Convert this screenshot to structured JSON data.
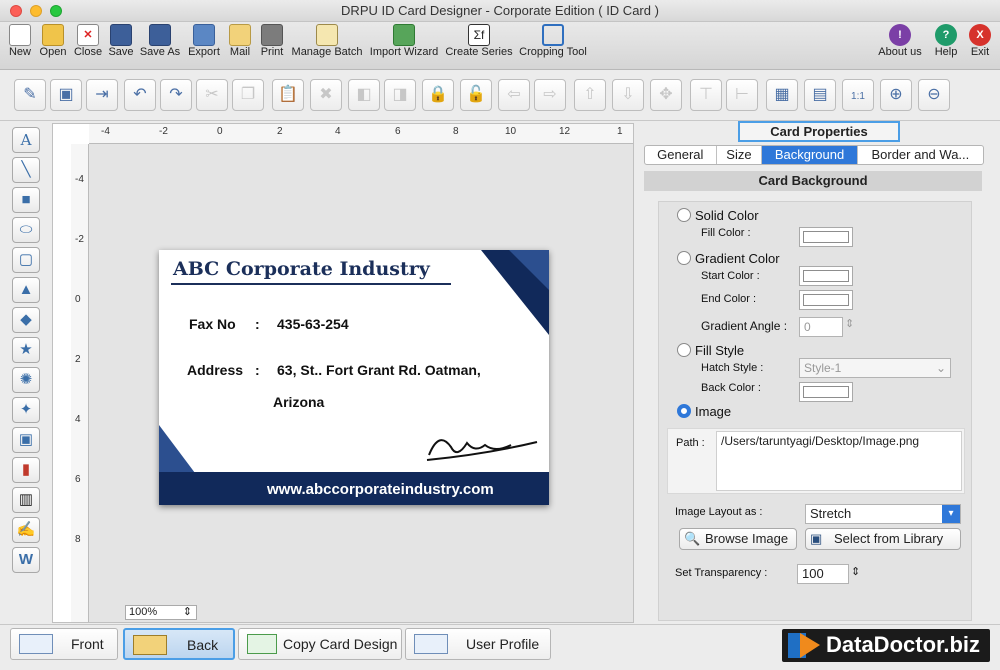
{
  "window": {
    "title": "DRPU ID Card Designer - Corporate Edition ( ID Card )"
  },
  "toolbar": {
    "items": [
      {
        "label": "New",
        "icon": "new-document-icon"
      },
      {
        "label": "Open",
        "icon": "open-folder-icon"
      },
      {
        "label": "Close",
        "icon": "close-document-icon"
      },
      {
        "label": "Save",
        "icon": "save-icon"
      },
      {
        "label": "Save As",
        "icon": "save-as-icon"
      },
      {
        "label": "Export",
        "icon": "export-icon"
      },
      {
        "label": "Mail",
        "icon": "mail-icon"
      },
      {
        "label": "Print",
        "icon": "printer-icon"
      },
      {
        "label": "Manage Batch",
        "icon": "manage-batch-icon"
      },
      {
        "label": "Import Wizard",
        "icon": "import-wizard-icon"
      },
      {
        "label": "Create Series",
        "icon": "create-series-icon"
      },
      {
        "label": "Cropping Tool",
        "icon": "crop-icon"
      }
    ],
    "right": [
      {
        "label": "About us",
        "icon": "info-icon",
        "color": "#7b3fa6"
      },
      {
        "label": "Help",
        "icon": "help-icon",
        "color": "#1f9b6a"
      },
      {
        "label": "Exit",
        "icon": "exit-icon",
        "color": "#d6322c"
      }
    ]
  },
  "ruler": {
    "h_ticks": [
      "-4",
      "-2",
      "0",
      "2",
      "4",
      "6",
      "8",
      "10",
      "12",
      "1"
    ],
    "v_ticks": [
      "-4",
      "-2",
      "0",
      "2",
      "4",
      "6",
      "8"
    ]
  },
  "zoom": {
    "value": "100%"
  },
  "card": {
    "title": "ABC Corporate Industry",
    "fax_label": "Fax No",
    "fax_sep": ":",
    "fax_value": "435-63-254",
    "address_label": "Address",
    "address_sep": ":",
    "address_line1": "63, St.. Fort Grant Rd. Oatman,",
    "address_line2": "Arizona",
    "website": "www.abccorporateindustry.com",
    "colors": {
      "navy": "#11295a",
      "accent": "#1b3a74"
    }
  },
  "panel": {
    "title": "Card Properties",
    "tabs": [
      "General",
      "Size",
      "Background",
      "Border and Wa..."
    ],
    "active_tab": "Background",
    "section": "Card Background",
    "solid_color": "Solid Color",
    "fill_color": "Fill Color :",
    "gradient_color": "Gradient Color",
    "start_color": "Start Color :",
    "end_color": "End Color :",
    "gradient_angle": "Gradient Angle :",
    "gradient_angle_value": "0",
    "fill_style": "Fill Style",
    "hatch_style": "Hatch Style :",
    "hatch_value": "Style-1",
    "back_color": "Back Color :",
    "image": "Image",
    "path_label": "Path :",
    "path_value": "/Users/taruntyagi/Desktop/Image.png",
    "layout_label": "Image Layout as :",
    "layout_value": "Stretch",
    "browse": "Browse Image",
    "library": "Select from Library",
    "transparency_label": "Set Transparency :",
    "transparency_value": "100"
  },
  "bottom": {
    "front": "Front",
    "back": "Back",
    "copy": "Copy Card Design",
    "profile": "User Profile",
    "brand": "DataDoctor.biz"
  }
}
